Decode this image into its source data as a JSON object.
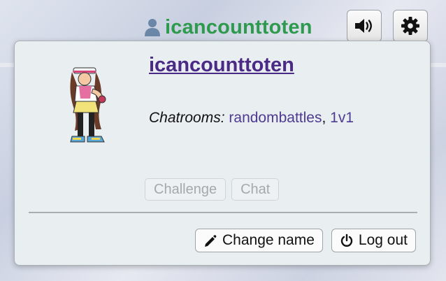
{
  "topbar": {
    "username": "icancounttoten",
    "icons": {
      "user": "person-icon",
      "sound": "speaker-icon",
      "settings": "gear-icon"
    }
  },
  "popup": {
    "name": "icancounttoten",
    "chatrooms_label": "Chatrooms:",
    "rooms": [
      "randombattles",
      "1v1"
    ],
    "room_separator": ", ",
    "challenge_label": "Challenge",
    "chat_label": "Chat",
    "change_name_label": "Change name",
    "logout_label": "Log out",
    "icons": {
      "change_name": "pencil-icon",
      "logout": "power-icon",
      "avatar": "trainer-avatar"
    }
  },
  "colors": {
    "username": "#2e9a4d",
    "link": "#4b2a86",
    "room_link": "#4f3a92"
  }
}
